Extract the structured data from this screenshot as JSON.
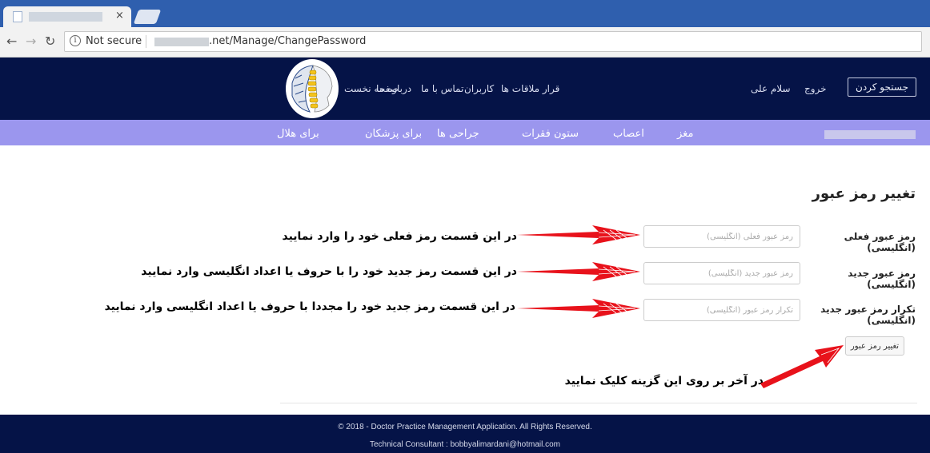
{
  "browser": {
    "tab_close": "×",
    "security_label": "Not secure",
    "url_visible": ".net/Manage/ChangePassword"
  },
  "header": {
    "nav_items": [
      "قرار ملاقات ها",
      "کاربران",
      "تماس با ما",
      "درباره ما",
      "صفحه نخست"
    ],
    "user_greeting": "سلام علی",
    "logout": "خروج",
    "search_button": "جستجو کردن"
  },
  "subnav": {
    "items": [
      "مغز",
      "اعصاب",
      "ستون فقرات",
      "جراحی ها",
      "برای پزشکان",
      "برای هلال"
    ]
  },
  "form": {
    "title": "تغییر رمز عبور",
    "fields": [
      {
        "label": "رمز عبور فعلی (انگلیسی)",
        "placeholder": "رمز عبور فعلی (انگلیسی)"
      },
      {
        "label": "رمز عبور جدید (انگلیسی)",
        "placeholder": "رمز عبور جدید (انگلیسی)"
      },
      {
        "label": "تکرار رمز عبور جدید (انگلیسی)",
        "placeholder": "تکرار رمز عبور (انگلیسی)"
      }
    ],
    "submit": "تغییر رمز عبور"
  },
  "annotations": [
    "در این قسمت رمز فعلی خود را وارد نمایید",
    "در این قسمت رمز جدید خود را با حروف یا اعداد انگلیسی وارد نمایید",
    "در این قسمت رمز جدید خود را مجددا با حروف یا اعداد انگلیسی وارد نمایید",
    "در آخر بر روی این گزینه کلیک نمایید"
  ],
  "footer": {
    "copyright": "© 2018 - Doctor Practice Management Application. All Rights Reserved.",
    "consultant": "Technical Consultant : bobbyalimardani@hotmail.com"
  },
  "colors": {
    "header_bg": "#051347",
    "subnav_bg": "#9b96ee",
    "arrow": "#e8121b"
  }
}
